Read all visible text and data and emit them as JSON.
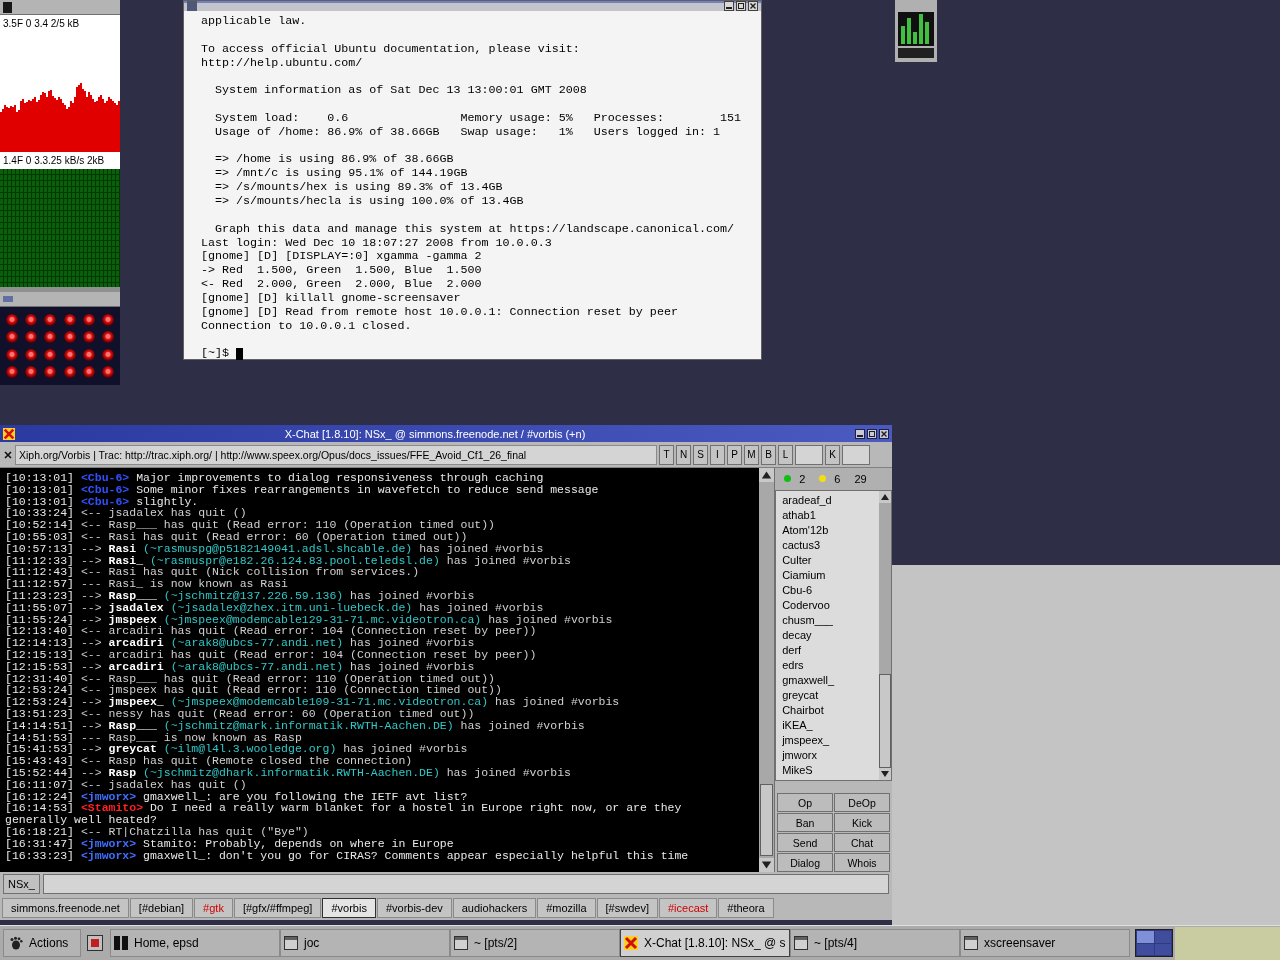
{
  "monitor_widget": {
    "graphs": [
      {
        "kind": "traffic",
        "reading": "3.5F 0 3.4 2/5 kB"
      },
      {
        "kind": "load",
        "reading": "1.4F 0 3.3.25 kB/s 2kB"
      }
    ]
  },
  "terminal": {
    "blocks": [
      [
        "applicable law."
      ],
      [
        "To access official Ubuntu documentation, please visit:",
        "http://help.ubuntu.com/"
      ],
      [
        "  System information as of Sat Dec 13 13:00:01 GMT 2008"
      ],
      [
        "  System load:    0.6                Memory usage: 5%   Processes:        151",
        "  Usage of /home: 86.9% of 38.66GB   Swap usage:   1%   Users logged in: 1"
      ],
      [
        "  => /home is using 86.9% of 38.66GB",
        "  => /mnt/c is using 95.1% of 144.19GB",
        "  => /s/mounts/hex is using 89.3% of 13.4GB",
        "  => /s/mounts/hecla is using 100.0% of 13.4GB"
      ],
      [
        "  Graph this data and manage this system at https://landscape.canonical.com/",
        "Last login: Wed Dec 10 18:07:27 2008 from 10.0.0.3",
        "[gnome] [D] [DISPLAY=:0] xgamma -gamma 2",
        "-> Red  1.500, Green  1.500, Blue  1.500",
        "<- Red  2.000, Green  2.000, Blue  2.000",
        "[gnome] [D] killall gnome-screensaver",
        "[gnome] [D] Read from remote host 10.0.0.1: Connection reset by peer",
        "Connection to 10.0.0.1 closed."
      ]
    ],
    "prompt": "[~]$"
  },
  "irc": {
    "title": "X-Chat [1.8.10]: NSx_ @ simmons.freenode.net / #vorbis (+n)",
    "topic": "Xiph.org/Vorbis | Trac: http://trac.xiph.org/ | http://www.speex.org/Opus/docs_issues/FFE_Avoid_Cf1_26_final",
    "mode_buttons": [
      {
        "label": "T",
        "kind": "toggle"
      },
      {
        "label": "N",
        "kind": "toggle"
      },
      {
        "label": "S",
        "kind": "toggle"
      },
      {
        "label": "I",
        "kind": "toggle"
      },
      {
        "label": "P",
        "kind": "toggle"
      },
      {
        "label": "M",
        "kind": "toggle"
      },
      {
        "label": "B",
        "kind": "toggle"
      },
      {
        "label": "L",
        "kind": "entry"
      },
      {
        "label": "K",
        "kind": "entry"
      }
    ],
    "messages": [
      {
        "kind": "say",
        "time": "[10:13:01]",
        "nick": "<Cbu-6>",
        "color": "#3050ff",
        "text": "Major improvements to dialog responsiveness through caching"
      },
      {
        "kind": "say",
        "time": "[10:13:01]",
        "nick": "<Cbu-6>",
        "color": "#3050ff",
        "text": "Some minor fixes rearrangements in wavefetch to reduce send message"
      },
      {
        "kind": "say",
        "time": "[10:13:01]",
        "nick": "<Cbu-6>",
        "color": "#3050ff",
        "text": "slightly."
      },
      {
        "kind": "event",
        "time": "[10:33:24]",
        "arrow": "<--",
        "text": "jsadalex has quit ()"
      },
      {
        "kind": "event",
        "time": "[10:52:14]",
        "arrow": "<--",
        "text": "Rasp___ has quit (Read error: 110 (Operation timed out))"
      },
      {
        "kind": "event",
        "time": "[10:55:03]",
        "arrow": "<--",
        "text": "Rasi has quit (Read error: 60 (Operation timed out))"
      },
      {
        "kind": "join",
        "time": "[10:57:13]",
        "arrow": "-->",
        "nick": "Rasi",
        "host": "(~rasmuspg@p5182149041.adsl.shcable.de)",
        "text": "has joined #vorbis"
      },
      {
        "kind": "join",
        "time": "[11:12:33]",
        "arrow": "-->",
        "nick": "Rasi_",
        "host": "(~rasmuspr@e182.26.124.83.pool.teledsl.de)",
        "text": "has joined #vorbis"
      },
      {
        "kind": "event",
        "time": "[11:12:43]",
        "arrow": "<--",
        "text": "Rasi has quit (Nick collision from services.)"
      },
      {
        "kind": "event",
        "time": "[11:12:57]",
        "arrow": "---",
        "text": "Rasi_ is now known as Rasi"
      },
      {
        "kind": "join",
        "time": "[11:23:23]",
        "arrow": "-->",
        "nick": "Rasp___",
        "host": "(~jschmitz@137.226.59.136)",
        "text": "has joined #vorbis"
      },
      {
        "kind": "join",
        "time": "[11:55:07]",
        "arrow": "-->",
        "nick": "jsadalex",
        "host": "(~jsadalex@zhex.itm.uni-luebeck.de)",
        "text": "has joined #vorbis"
      },
      {
        "kind": "join",
        "time": "[11:55:24]",
        "arrow": "-->",
        "nick": "jmspeex",
        "host": "(~jmspeex@modemcable129-31-71.mc.videotron.ca)",
        "text": "has joined #vorbis"
      },
      {
        "kind": "event",
        "time": "[12:13:40]",
        "arrow": "<--",
        "text": "arcadiri has quit (Read error: 104 (Connection reset by peer))"
      },
      {
        "kind": "join",
        "time": "[12:14:13]",
        "arrow": "-->",
        "nick": "arcadiri",
        "host": "(~arak8@ubcs-77.andi.net)",
        "text": "has joined #vorbis"
      },
      {
        "kind": "event",
        "time": "[12:15:13]",
        "arrow": "<--",
        "text": "arcadiri has quit (Read error: 104 (Connection reset by peer))"
      },
      {
        "kind": "join",
        "time": "[12:15:53]",
        "arrow": "-->",
        "nick": "arcadiri",
        "host": "(~arak8@ubcs-77.andi.net)",
        "text": "has joined #vorbis"
      },
      {
        "kind": "event",
        "time": "[12:31:40]",
        "arrow": "<--",
        "text": "Rasp___ has quit (Read error: 110 (Operation timed out))"
      },
      {
        "kind": "event",
        "time": "[12:53:24]",
        "arrow": "<--",
        "text": "jmspeex has quit (Read error: 110 (Connection timed out))"
      },
      {
        "kind": "join",
        "time": "[12:53:24]",
        "arrow": "-->",
        "nick": "jmspeex_",
        "host": "(~jmspeex@modemcable109-31-71.mc.videotron.ca)",
        "text": "has joined #vorbis"
      },
      {
        "kind": "event",
        "time": "[13:51:23]",
        "arrow": "<--",
        "text": "nessy has quit (Read error: 60 (Operation timed out))"
      },
      {
        "kind": "join",
        "time": "[14:14:51]",
        "arrow": "-->",
        "nick": "Rasp___",
        "host": "(~jschmitz@mark.informatik.RWTH-Aachen.DE)",
        "text": "has joined #vorbis"
      },
      {
        "kind": "event",
        "time": "[14:51:53]",
        "arrow": "---",
        "text": "Rasp___ is now known as Rasp"
      },
      {
        "kind": "join",
        "time": "[15:41:53]",
        "arrow": "-->",
        "nick": "greycat",
        "host": "(~ilm@l4l.3.wooledge.org)",
        "text": "has joined #vorbis"
      },
      {
        "kind": "event",
        "time": "[15:43:43]",
        "arrow": "<--",
        "text": "Rasp has quit (Remote closed the connection)"
      },
      {
        "kind": "join",
        "time": "[15:52:44]",
        "arrow": "-->",
        "nick": "Rasp",
        "host": "(~jschmitz@dhark.informatik.RWTH-Aachen.DE)",
        "text": "has joined #vorbis"
      },
      {
        "kind": "event",
        "time": "[16:11:07]",
        "arrow": "<--",
        "text": "jsadalex has quit ()"
      },
      {
        "kind": "say",
        "time": "[16:12:24]",
        "nick": "<jmworx>",
        "color": "#4070ff",
        "text": "gmaxwell_: are you following the IETF avt list?"
      },
      {
        "kind": "say",
        "time": "[16:14:53]",
        "nick": "<Stamito>",
        "color": "#ff2020",
        "text": "Do I need a really warm blanket for a hostel in Europe right now, or are they",
        "continuation": "generally well heated?"
      },
      {
        "kind": "event",
        "time": "[16:18:21]",
        "arrow": "<--",
        "text": "RT|Chatzilla has quit (\"Bye\")"
      },
      {
        "kind": "say",
        "time": "[16:31:47]",
        "nick": "<jmworx>",
        "color": "#4070ff",
        "text": "Stamito: Probably, depends on where in Europe"
      },
      {
        "kind": "say",
        "time": "[16:33:23]",
        "nick": "<jmworx>",
        "color": "#4070ff",
        "text": "gmaxwell_: don't you go for CIRAS? Comments appear especially helpful this time"
      }
    ],
    "user_counts": [
      {
        "kind": "op",
        "text": "2"
      },
      {
        "kind": "voice",
        "text": "6"
      },
      {
        "kind": "total",
        "text": "29"
      }
    ],
    "nicks": [
      "aradeaf_d",
      "athab1",
      "Atom'12b",
      "cactus3",
      "Culter",
      "Ciamium",
      "Cbu-6",
      "Codervoo",
      "chusm___",
      "decay",
      "derf",
      "edrs",
      "gmaxwell_",
      "greycat",
      "Chairbot",
      "iKEA_",
      "jmspeex_",
      "jmworx",
      "MikeS"
    ],
    "user_buttons": [
      "Op",
      "DeOp",
      "Ban",
      "Kick",
      "Send",
      "Chat",
      "Dialog",
      "Whois"
    ],
    "nick_button": "NSx_",
    "channel_tabs": [
      {
        "label": "simmons.freenode.net",
        "selected": false,
        "highlighted": false
      },
      {
        "label": "[#debian]",
        "selected": false,
        "highlighted": false
      },
      {
        "label": "#gtk",
        "selected": false,
        "highlighted": true
      },
      {
        "label": "[#gfx/#ffmpeg]",
        "selected": false,
        "highlighted": false
      },
      {
        "label": "#vorbis",
        "selected": true,
        "highlighted": false
      },
      {
        "label": "#vorbis-dev",
        "selected": false,
        "highlighted": false
      },
      {
        "label": "audiohackers",
        "selected": false,
        "highlighted": false
      },
      {
        "label": "#mozilla",
        "selected": false,
        "highlighted": false
      },
      {
        "label": "[#swdev]",
        "selected": false,
        "highlighted": false
      },
      {
        "label": "#icecast",
        "selected": false,
        "highlighted": true
      },
      {
        "label": "#theora",
        "selected": false,
        "highlighted": false
      }
    ]
  },
  "taskbar": {
    "menu": "Actions",
    "tasks": [
      {
        "label": "Home, epsd",
        "kind": "terminal",
        "selected": false
      },
      {
        "label": "joc",
        "kind": "window",
        "selected": false
      },
      {
        "label": "~ [pts/2]",
        "kind": "window",
        "selected": false
      },
      {
        "label": "X-Chat [1.8.10]: NSx_ @ s",
        "kind": "chat",
        "selected": true
      },
      {
        "label": "~ [pts/4]",
        "kind": "window",
        "selected": false
      },
      {
        "label": "xscreensaver",
        "kind": "window",
        "selected": false
      }
    ],
    "workspaces": [
      {
        "selected": true
      },
      {
        "selected": false
      },
      {
        "selected": false
      },
      {
        "selected": false
      }
    ]
  }
}
